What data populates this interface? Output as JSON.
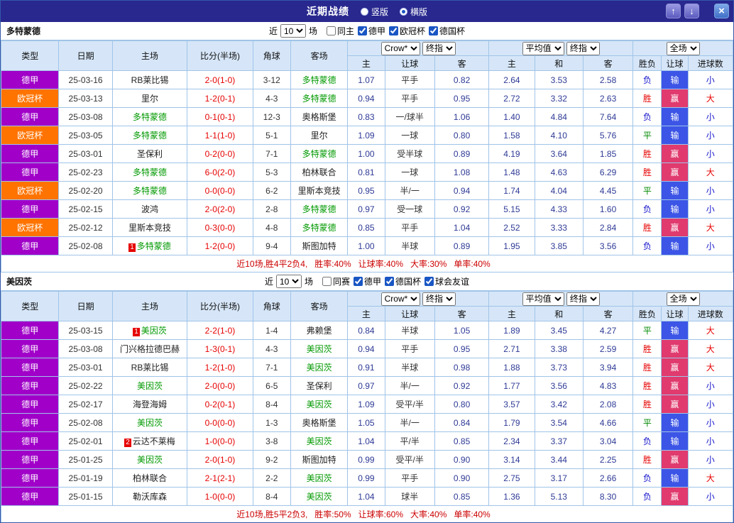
{
  "titlebar": {
    "title": "近期战绩",
    "radios": [
      {
        "label": "竖版",
        "selected": false
      },
      {
        "label": "横版",
        "selected": true
      }
    ]
  },
  "icons": {
    "up_arrow": "↑",
    "down_arrow": "↓",
    "close": "×"
  },
  "labels": {
    "near": "近",
    "games": "场"
  },
  "header": {
    "cols": [
      "类型",
      "日期",
      "主场",
      "比分(半场)",
      "角球",
      "客场"
    ],
    "sub": [
      "主",
      "让球",
      "客",
      "主",
      "和",
      "客",
      "胜负",
      "让球",
      "进球数"
    ],
    "selects": {
      "book": "Crow*",
      "final": "终指",
      "avg": "平均值",
      "full": "全场"
    }
  },
  "colors": {
    "css_vars": {
      "titlebar-bg": "#28288f",
      "grid": "#a0c4e8",
      "header-bg": "#d6e6f8",
      "score": "#e60000",
      "odds": "#2e3a96",
      "summary": "#cc0000"
    },
    "league": {
      "德甲": "#a000c8",
      "欧冠杯": "#ff7300"
    },
    "result": {
      "胜": "#e60000",
      "平": "#008800",
      "负": "#1414cc"
    },
    "handicap": {
      "赢": "#e03a6e",
      "输": "#3c55e6"
    },
    "goals": {
      "大": "#e60000",
      "小": "#1414cc"
    },
    "focus_team": "#009900",
    "rank_badge": "#e60000"
  },
  "sections": [
    {
      "team": "多特蒙德",
      "near_count": "10",
      "filters": [
        {
          "label": "同主",
          "checked": false
        },
        {
          "label": "德甲",
          "checked": true
        },
        {
          "label": "欧冠杯",
          "checked": true
        },
        {
          "label": "德国杯",
          "checked": true
        }
      ],
      "rows": [
        {
          "league": "德甲",
          "date": "25-03-16",
          "home": "RB莱比锡",
          "score": "2-0(1-0)",
          "corner": "3-12",
          "away": "多特蒙德",
          "away_focus": true,
          "odds": [
            "1.07",
            "平手",
            "0.82"
          ],
          "avg": [
            "2.64",
            "3.53",
            "2.58"
          ],
          "result": "负",
          "handicap": "输",
          "goals": "小"
        },
        {
          "league": "欧冠杯",
          "date": "25-03-13",
          "home": "里尔",
          "score": "1-2(0-1)",
          "corner": "4-3",
          "away": "多特蒙德",
          "away_focus": true,
          "odds": [
            "0.94",
            "平手",
            "0.95"
          ],
          "avg": [
            "2.72",
            "3.32",
            "2.63"
          ],
          "result": "胜",
          "handicap": "赢",
          "goals": "大"
        },
        {
          "league": "德甲",
          "date": "25-03-08",
          "home": "多特蒙德",
          "home_focus": true,
          "score": "0-1(0-1)",
          "corner": "12-3",
          "away": "奥格斯堡",
          "odds": [
            "0.83",
            "一/球半",
            "1.06"
          ],
          "avg": [
            "1.40",
            "4.84",
            "7.64"
          ],
          "result": "负",
          "handicap": "输",
          "goals": "小"
        },
        {
          "league": "欧冠杯",
          "date": "25-03-05",
          "home": "多特蒙德",
          "home_focus": true,
          "score": "1-1(1-0)",
          "corner": "5-1",
          "away": "里尔",
          "odds": [
            "1.09",
            "一球",
            "0.80"
          ],
          "avg": [
            "1.58",
            "4.10",
            "5.76"
          ],
          "result": "平",
          "handicap": "输",
          "goals": "小"
        },
        {
          "league": "德甲",
          "date": "25-03-01",
          "home": "圣保利",
          "score": "0-2(0-0)",
          "corner": "7-1",
          "away": "多特蒙德",
          "away_focus": true,
          "odds": [
            "1.00",
            "受半球",
            "0.89"
          ],
          "avg": [
            "4.19",
            "3.64",
            "1.85"
          ],
          "result": "胜",
          "handicap": "赢",
          "goals": "小"
        },
        {
          "league": "德甲",
          "date": "25-02-23",
          "home": "多特蒙德",
          "home_focus": true,
          "score": "6-0(2-0)",
          "corner": "5-3",
          "away": "柏林联合",
          "odds": [
            "0.81",
            "一球",
            "1.08"
          ],
          "avg": [
            "1.48",
            "4.63",
            "6.29"
          ],
          "result": "胜",
          "handicap": "赢",
          "goals": "大"
        },
        {
          "league": "欧冠杯",
          "date": "25-02-20",
          "home": "多特蒙德",
          "home_focus": true,
          "score": "0-0(0-0)",
          "corner": "6-2",
          "away": "里斯本竞技",
          "odds": [
            "0.95",
            "半/一",
            "0.94"
          ],
          "avg": [
            "1.74",
            "4.04",
            "4.45"
          ],
          "result": "平",
          "handicap": "输",
          "goals": "小"
        },
        {
          "league": "德甲",
          "date": "25-02-15",
          "home": "波鸿",
          "score": "2-0(2-0)",
          "corner": "2-8",
          "away": "多特蒙德",
          "away_focus": true,
          "odds": [
            "0.97",
            "受一球",
            "0.92"
          ],
          "avg": [
            "5.15",
            "4.33",
            "1.60"
          ],
          "result": "负",
          "handicap": "输",
          "goals": "小"
        },
        {
          "league": "欧冠杯",
          "date": "25-02-12",
          "home": "里斯本竞技",
          "score": "0-3(0-0)",
          "corner": "4-8",
          "away": "多特蒙德",
          "away_focus": true,
          "odds": [
            "0.85",
            "平手",
            "1.04"
          ],
          "avg": [
            "2.52",
            "3.33",
            "2.84"
          ],
          "result": "胜",
          "handicap": "赢",
          "goals": "大"
        },
        {
          "league": "德甲",
          "date": "25-02-08",
          "home": "多特蒙德",
          "home_rank": "1",
          "home_focus": true,
          "score": "1-2(0-0)",
          "corner": "9-4",
          "away": "斯图加特",
          "odds": [
            "1.00",
            "半球",
            "0.89"
          ],
          "avg": [
            "1.95",
            "3.85",
            "3.56"
          ],
          "result": "负",
          "handicap": "输",
          "goals": "小"
        }
      ],
      "summary_parts": [
        "近10场,胜4平2负4,",
        "胜率:40%",
        "让球率:40%",
        "大率:30%",
        "单率:40%"
      ]
    },
    {
      "team": "美因茨",
      "near_count": "10",
      "filters": [
        {
          "label": "同赛",
          "checked": false
        },
        {
          "label": "德甲",
          "checked": true
        },
        {
          "label": "德国杯",
          "checked": true
        },
        {
          "label": "球会友谊",
          "checked": true
        }
      ],
      "rows": [
        {
          "league": "德甲",
          "date": "25-03-15",
          "home": "美因茨",
          "home_rank": "1",
          "home_focus": true,
          "score": "2-2(1-0)",
          "corner": "1-4",
          "away": "弗赖堡",
          "odds": [
            "0.84",
            "半球",
            "1.05"
          ],
          "avg": [
            "1.89",
            "3.45",
            "4.27"
          ],
          "result": "平",
          "handicap": "输",
          "goals": "大"
        },
        {
          "league": "德甲",
          "date": "25-03-08",
          "home": "门兴格拉德巴赫",
          "score": "1-3(0-1)",
          "corner": "4-3",
          "away": "美因茨",
          "away_focus": true,
          "odds": [
            "0.94",
            "平手",
            "0.95"
          ],
          "avg": [
            "2.71",
            "3.38",
            "2.59"
          ],
          "result": "胜",
          "handicap": "赢",
          "goals": "大"
        },
        {
          "league": "德甲",
          "date": "25-03-01",
          "home": "RB莱比锡",
          "score": "1-2(1-0)",
          "corner": "7-1",
          "away": "美因茨",
          "away_focus": true,
          "odds": [
            "0.91",
            "半球",
            "0.98"
          ],
          "avg": [
            "1.88",
            "3.73",
            "3.94"
          ],
          "result": "胜",
          "handicap": "赢",
          "goals": "大"
        },
        {
          "league": "德甲",
          "date": "25-02-22",
          "home": "美因茨",
          "home_focus": true,
          "score": "2-0(0-0)",
          "corner": "6-5",
          "away": "圣保利",
          "odds": [
            "0.97",
            "半/一",
            "0.92"
          ],
          "avg": [
            "1.77",
            "3.56",
            "4.83"
          ],
          "result": "胜",
          "handicap": "赢",
          "goals": "小"
        },
        {
          "league": "德甲",
          "date": "25-02-17",
          "home": "海登海姆",
          "score": "0-2(0-1)",
          "corner": "8-4",
          "away": "美因茨",
          "away_focus": true,
          "odds": [
            "1.09",
            "受平/半",
            "0.80"
          ],
          "avg": [
            "3.57",
            "3.42",
            "2.08"
          ],
          "result": "胜",
          "handicap": "赢",
          "goals": "小"
        },
        {
          "league": "德甲",
          "date": "25-02-08",
          "home": "美因茨",
          "home_focus": true,
          "score": "0-0(0-0)",
          "corner": "1-3",
          "away": "奥格斯堡",
          "odds": [
            "1.05",
            "半/一",
            "0.84"
          ],
          "avg": [
            "1.79",
            "3.54",
            "4.66"
          ],
          "result": "平",
          "handicap": "输",
          "goals": "小"
        },
        {
          "league": "德甲",
          "date": "25-02-01",
          "home": "云达不莱梅",
          "home_rank": "2",
          "score": "1-0(0-0)",
          "corner": "3-8",
          "away": "美因茨",
          "away_focus": true,
          "odds": [
            "1.04",
            "平/半",
            "0.85"
          ],
          "avg": [
            "2.34",
            "3.37",
            "3.04"
          ],
          "result": "负",
          "handicap": "输",
          "goals": "小"
        },
        {
          "league": "德甲",
          "date": "25-01-25",
          "home": "美因茨",
          "home_focus": true,
          "score": "2-0(1-0)",
          "corner": "9-2",
          "away": "斯图加特",
          "odds": [
            "0.99",
            "受平/半",
            "0.90"
          ],
          "avg": [
            "3.14",
            "3.44",
            "2.25"
          ],
          "result": "胜",
          "handicap": "赢",
          "goals": "小"
        },
        {
          "league": "德甲",
          "date": "25-01-19",
          "home": "柏林联合",
          "score": "2-1(2-1)",
          "corner": "2-2",
          "away": "美因茨",
          "away_focus": true,
          "odds": [
            "0.99",
            "平手",
            "0.90"
          ],
          "avg": [
            "2.75",
            "3.17",
            "2.66"
          ],
          "result": "负",
          "handicap": "输",
          "goals": "大"
        },
        {
          "league": "德甲",
          "date": "25-01-15",
          "home": "勒沃库森",
          "score": "1-0(0-0)",
          "corner": "8-4",
          "away": "美因茨",
          "away_focus": true,
          "odds": [
            "1.04",
            "球半",
            "0.85"
          ],
          "avg": [
            "1.36",
            "5.13",
            "8.30"
          ],
          "result": "负",
          "handicap": "赢",
          "goals": "小"
        }
      ],
      "summary_parts": [
        "近10场,胜5平2负3,",
        "胜率:50%",
        "让球率:60%",
        "大率:40%",
        "单率:40%"
      ]
    }
  ]
}
